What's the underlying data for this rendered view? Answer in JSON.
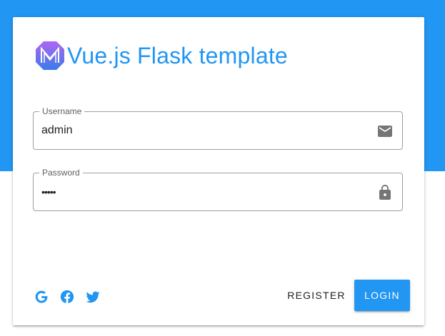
{
  "app": {
    "title": "Vue.js Flask template"
  },
  "form": {
    "username": {
      "label": "Username",
      "value": "admin",
      "icon": "email-icon"
    },
    "password": {
      "label": "Password",
      "value": "•••••",
      "icon": "lock-icon"
    }
  },
  "social": [
    {
      "name": "google-icon"
    },
    {
      "name": "facebook-icon"
    },
    {
      "name": "twitter-icon"
    }
  ],
  "actions": {
    "register_label": "REGISTER",
    "login_label": "LOGIN"
  },
  "colors": {
    "primary": "#2196f3",
    "logo_gradient_start": "#a855f7",
    "logo_gradient_end": "#3b82f6"
  }
}
